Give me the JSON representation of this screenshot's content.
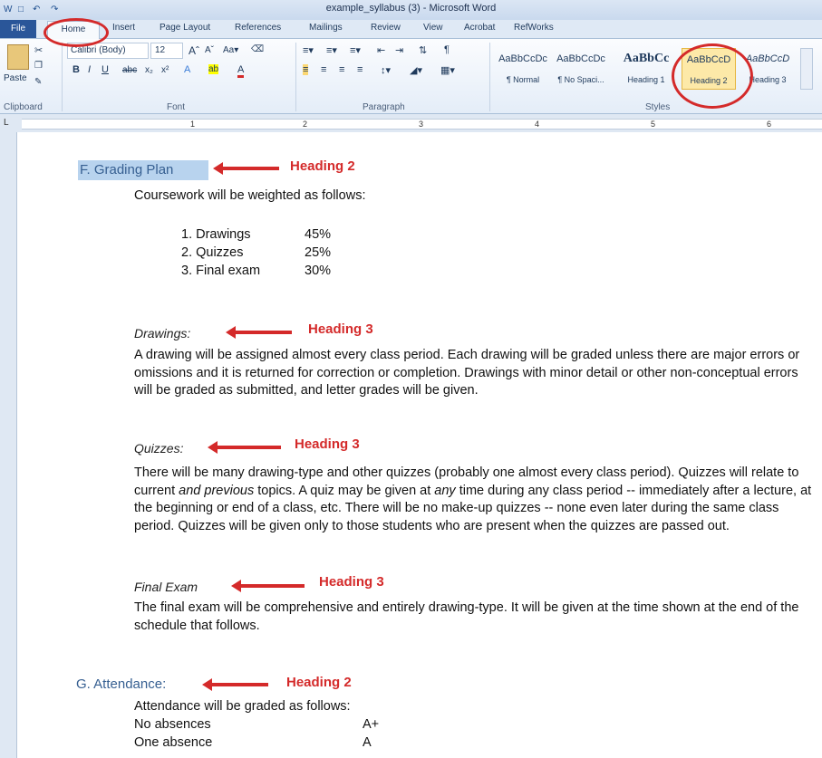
{
  "window": {
    "title": "example_syllabus (3) - Microsoft Word"
  },
  "tabs": [
    "File",
    "Home",
    "Insert",
    "Page Layout",
    "References",
    "Mailings",
    "Review",
    "View",
    "Acrobat",
    "RefWorks"
  ],
  "ribbon": {
    "paste_label": "Paste",
    "font_name": "Calibri (Body)",
    "font_size": "12",
    "groups": {
      "clipboard": "Clipboard",
      "font": "Font",
      "paragraph": "Paragraph",
      "styles": "Styles"
    },
    "styles": [
      {
        "sample": "AaBbCcDc",
        "name": "¶ Normal"
      },
      {
        "sample": "AaBbCcDc",
        "name": "¶ No Spaci..."
      },
      {
        "sample": "AaBbCc",
        "name": "Heading 1"
      },
      {
        "sample": "AaBbCcD",
        "name": "Heading 2"
      },
      {
        "sample": "AaBbCcD",
        "name": "Heading 3"
      }
    ]
  },
  "ruler_numbers": [
    "1",
    "2",
    "3",
    "4",
    "5",
    "6"
  ],
  "document": {
    "grading_heading": "F. Grading Plan",
    "grading_intro": "Coursework will be weighted as follows:",
    "weights": [
      {
        "item": "1. Drawings",
        "percent": "45%"
      },
      {
        "item": "2. Quizzes",
        "percent": "25%"
      },
      {
        "item": "3. Final exam",
        "percent": "30%"
      }
    ],
    "drawings_heading": "Drawings:",
    "drawings_text": "A drawing will be assigned almost every class period. Each drawing will be graded unless there are major errors or omissions and it is returned for correction or completion. Drawings with minor detail or other non-conceptual errors will be graded as submitted, and letter grades will be given.",
    "quizzes_heading": "Quizzes:",
    "quizzes_text_1": "There will be many drawing-type and other quizzes (probably one almost every class period). Quizzes will relate to current ",
    "quizzes_text_em1": "and previous",
    "quizzes_text_2": " topics. A quiz may be given at ",
    "quizzes_text_em2": "any",
    "quizzes_text_3": " time during any class period -- immediately after a lecture, at the beginning or end of a class, etc. There will be no make-up quizzes -- none even later during the same class period. Quizzes will be given only to those students who are present when the quizzes are passed out.",
    "final_heading": "Final  Exam",
    "final_text": "The final exam will be comprehensive and entirely drawing-type. It will be given at the time shown at the end of the schedule that follows.",
    "attendance_heading": "G. Attendance:",
    "attendance_intro": "Attendance will be graded as follows:",
    "attendance_rows": [
      {
        "absences": "No absences",
        "grade": "A+"
      },
      {
        "absences": "One absence",
        "grade": "A"
      }
    ]
  },
  "annotations": {
    "heading2": "Heading 2",
    "heading3": "Heading 3"
  },
  "colors": {
    "annotation_red": "#d42a2a",
    "heading_blue": "#365f91",
    "file_tab": "#2a5699"
  }
}
